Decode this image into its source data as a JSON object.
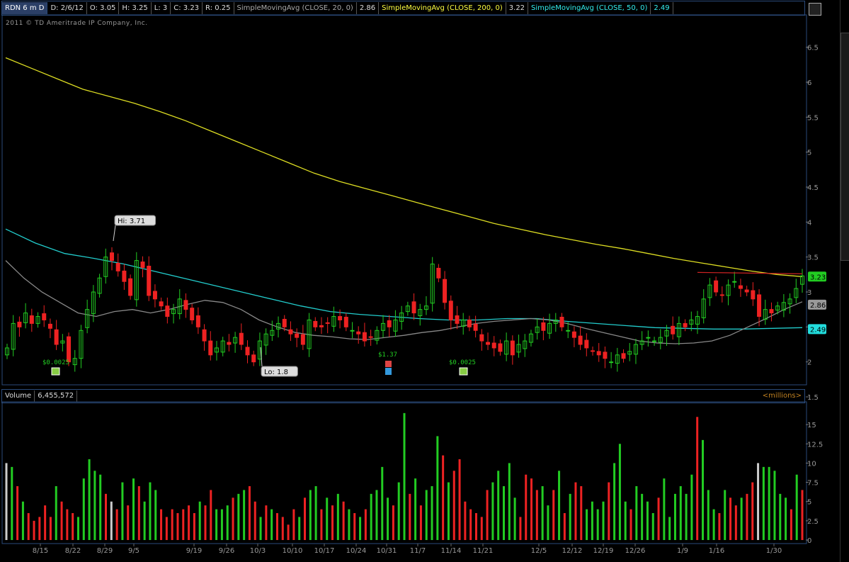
{
  "header": {
    "symbol": "RDN 6 m D",
    "date": "D: 2/6/12",
    "open": "O: 3.05",
    "high": "H: 3.25",
    "low": "L: 3",
    "close": "C: 3.23",
    "range": "R: 0.25",
    "sma20_label": "SimpleMovingAvg (CLOSE, 20, 0)",
    "sma20_value": "2.86",
    "sma200_label": "SimpleMovingAvg (CLOSE, 200, 0)",
    "sma200_value": "3.22",
    "sma50_label": "SimpleMovingAvg (CLOSE, 50, 0)",
    "sma50_value": "2.49"
  },
  "copyright": "2011 © TD Ameritrade IP Company, Inc.",
  "volume_header": {
    "label": "Volume",
    "value": "6,455,572",
    "unit": "<millions>"
  },
  "colors": {
    "up": "#22cc22",
    "down": "#ee2222",
    "sma20": "#888888",
    "sma200": "#dddd22",
    "sma50": "#22cccc",
    "resistance": "#cc2222"
  },
  "chart_data": [
    {
      "type": "candlestick",
      "title": "RDN 6 m D",
      "ylim": [
        1.5,
        6.75
      ],
      "yticks": [
        1.5,
        2,
        2.5,
        3,
        3.5,
        4,
        4.5,
        5,
        5.5,
        6,
        6.5
      ],
      "xticks": [
        "8/15",
        "8/22",
        "8/29",
        "9/5",
        "9/19",
        "9/26",
        "10/3",
        "10/10",
        "10/17",
        "10/24",
        "10/31",
        "11/7",
        "11/14",
        "11/21",
        "12/5",
        "12/12",
        "12/19",
        "12/26",
        "1/9",
        "1/16",
        "1/30"
      ],
      "annotations": {
        "high": "Hi: 3.71",
        "low": "Lo: 1.8",
        "dividend1": "$0.0025",
        "earnings": "$1.37",
        "dividend2": "$0.0025"
      },
      "price_labels": {
        "close": "3.23",
        "sma20": "2.86",
        "sma50": "2.49"
      },
      "closes": [
        2.2,
        2.55,
        2.5,
        2.7,
        2.55,
        2.65,
        2.6,
        2.48,
        2.25,
        2.3,
        2.0,
        2.05,
        2.45,
        2.75,
        3.0,
        3.2,
        3.5,
        3.45,
        3.3,
        3.15,
        2.95,
        3.45,
        3.35,
        2.95,
        2.9,
        2.8,
        2.65,
        2.75,
        2.9,
        2.75,
        2.6,
        2.5,
        2.3,
        2.1,
        2.2,
        2.3,
        2.25,
        2.35,
        2.25,
        2.1,
        2.0,
        2.3,
        2.4,
        2.45,
        2.55,
        2.5,
        2.4,
        2.35,
        2.25,
        2.6,
        2.5,
        2.5,
        2.55,
        2.65,
        2.6,
        2.5,
        2.45,
        2.4,
        2.3,
        2.35,
        2.45,
        2.55,
        2.5,
        2.6,
        2.7,
        2.8,
        2.7,
        2.75,
        2.8,
        3.4,
        3.2,
        2.85,
        2.6,
        2.55,
        2.6,
        2.5,
        2.45,
        2.3,
        2.25,
        2.2,
        2.15,
        2.3,
        2.1,
        2.25,
        2.3,
        2.4,
        2.5,
        2.45,
        2.55,
        2.6,
        2.5,
        2.45,
        2.35,
        2.25,
        2.2,
        2.15,
        2.1,
        2.05,
        2.0,
        2.1,
        2.05,
        2.15,
        2.25,
        2.3,
        2.35,
        2.3,
        2.35,
        2.45,
        2.4,
        2.55,
        2.5,
        2.6,
        2.65,
        2.9,
        3.1,
        3.0,
        2.95,
        3.1,
        3.15,
        3.05,
        3.0,
        2.9,
        2.65,
        2.75,
        2.7,
        2.8,
        2.85,
        2.9,
        3.05,
        3.23
      ],
      "sma20": [
        3.45,
        3.2,
        3.0,
        2.85,
        2.7,
        2.65,
        2.72,
        2.75,
        2.7,
        2.75,
        2.82,
        2.88,
        2.85,
        2.75,
        2.6,
        2.5,
        2.42,
        2.38,
        2.36,
        2.33,
        2.32,
        2.35,
        2.38,
        2.42,
        2.45,
        2.5,
        2.55,
        2.58,
        2.6,
        2.62,
        2.6,
        2.55,
        2.48,
        2.42,
        2.36,
        2.3,
        2.27,
        2.26,
        2.27,
        2.3,
        2.38,
        2.5,
        2.62,
        2.75,
        2.86
      ],
      "sma200": [
        6.35,
        6.2,
        6.05,
        5.9,
        5.8,
        5.7,
        5.58,
        5.45,
        5.3,
        5.15,
        5.0,
        4.85,
        4.7,
        4.58,
        4.48,
        4.38,
        4.28,
        4.18,
        4.08,
        3.98,
        3.9,
        3.82,
        3.75,
        3.68,
        3.62,
        3.55,
        3.48,
        3.42,
        3.36,
        3.3,
        3.25,
        3.22
      ],
      "sma50": [
        3.9,
        3.7,
        3.55,
        3.48,
        3.4,
        3.3,
        3.2,
        3.1,
        3.0,
        2.9,
        2.8,
        2.72,
        2.68,
        2.65,
        2.62,
        2.6,
        2.6,
        2.62,
        2.62,
        2.58,
        2.55,
        2.52,
        2.49,
        2.48,
        2.47,
        2.47,
        2.48,
        2.49
      ]
    },
    {
      "type": "bar",
      "title": "Volume",
      "ylabel": "<millions>",
      "ylim": [
        0,
        17.5
      ],
      "yticks": [
        0,
        2.5,
        5,
        7.5,
        10,
        12.5,
        15
      ],
      "values": [
        10,
        9.5,
        7,
        5,
        3.5,
        2.5,
        3,
        4.5,
        3,
        7,
        5,
        4,
        3.5,
        3,
        8,
        10.5,
        9,
        8.5,
        6,
        5,
        4,
        7.5,
        4.5,
        8,
        7,
        5,
        7.5,
        6.5,
        4,
        3,
        4,
        3.5,
        4,
        4.5,
        3.5,
        5,
        4.5,
        6.5,
        4,
        4,
        4.5,
        5.5,
        6,
        6.5,
        7,
        5,
        3,
        4.5,
        4,
        3.5,
        3,
        2,
        4,
        3,
        5.5,
        6.5,
        7,
        4,
        5.5,
        4.5,
        6,
        5,
        4,
        3.5,
        3,
        4,
        6,
        6.5,
        9.5,
        5.5,
        4.5,
        7.5,
        16.5,
        6,
        8,
        4.5,
        6.5,
        7,
        13.5,
        11,
        7.5,
        9,
        10.5,
        5,
        4,
        3.5,
        3,
        6.5,
        7.5,
        9,
        7,
        10,
        5.5,
        3,
        8.5,
        8,
        6.5,
        7,
        4.5,
        6.5,
        9,
        3.5,
        6,
        7.5,
        7,
        4,
        5,
        4,
        5,
        7.5,
        10,
        12.5,
        5,
        4,
        7,
        6,
        5,
        3.5,
        5.5,
        8,
        3,
        6,
        7,
        6,
        8.5,
        16,
        13,
        6.5,
        4,
        3.5,
        6.5,
        5.5,
        4.5,
        5.5,
        6,
        7.5,
        10,
        9.5,
        9.5,
        9,
        6,
        5.5,
        4,
        8.5,
        6.5
      ],
      "colors_up": [
        1,
        1,
        0,
        1,
        0,
        0,
        0,
        0,
        0,
        1,
        0,
        0,
        0,
        1,
        1,
        1,
        1,
        1,
        0,
        0,
        0,
        1,
        0,
        1,
        0,
        1,
        1,
        1,
        0,
        0,
        0,
        0,
        0,
        0,
        0,
        1,
        0,
        0,
        1,
        1,
        1,
        0,
        1,
        1,
        0,
        0,
        1,
        0,
        1,
        0,
        0,
        0,
        0,
        1,
        0,
        1,
        1,
        0,
        1,
        0,
        1,
        0,
        1,
        0,
        1,
        0,
        1,
        1,
        1,
        1,
        0,
        1,
        1,
        0,
        1,
        0,
        1,
        1,
        1,
        0,
        1,
        0,
        0,
        0,
        0,
        0,
        0,
        0,
        1,
        1,
        1,
        1,
        1,
        0,
        0,
        0,
        0,
        1,
        1,
        0,
        1,
        0,
        1,
        0,
        0,
        1,
        1,
        1,
        1,
        0,
        1,
        1,
        1,
        0,
        1,
        1,
        1,
        1,
        0,
        1,
        1,
        1,
        1,
        1,
        1,
        0,
        1,
        1,
        1,
        0,
        1,
        0,
        0,
        1,
        0,
        0,
        0,
        1,
        1,
        1,
        1,
        1,
        0,
        1
      ]
    }
  ]
}
